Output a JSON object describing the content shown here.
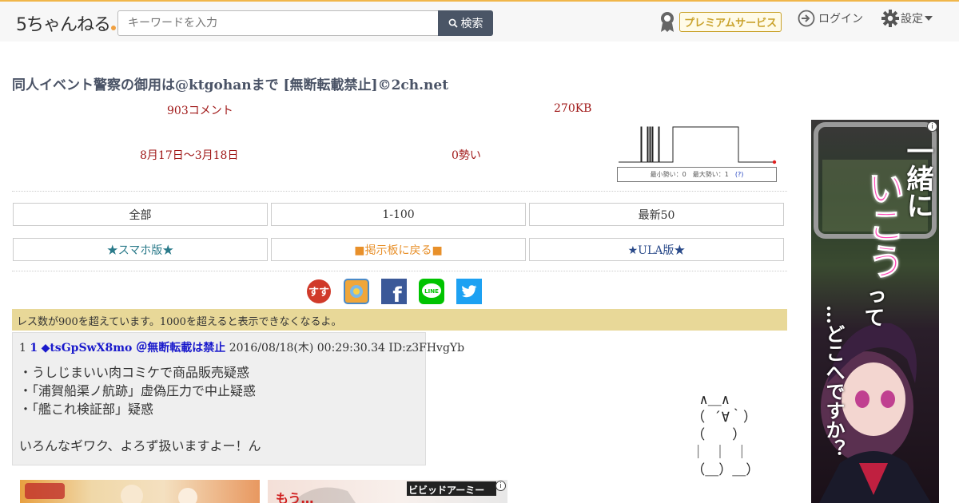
{
  "header": {
    "logo": "5ちゃんねる",
    "search_placeholder": "キーワードを入力",
    "search_button": "検索",
    "premium": "プレミアムサービス",
    "login": "ログイン",
    "settings": "設定"
  },
  "thread": {
    "title": "同人イベント警察の御用は@ktgohanまで [無断転載禁止]©2ch.net",
    "comments": "903コメント",
    "size": "270KB",
    "date_range": "8月17日〜3月18日",
    "momentum": "0勢い",
    "graph_legend_min": "最小勢い：0",
    "graph_legend_max": "最大勢い：1",
    "graph_legend_help": "(?)"
  },
  "nav": {
    "all": "全部",
    "range": "1-100",
    "latest": "最新50",
    "smartphone": "★スマホ版★",
    "back_board": "■掲示板に戻る■",
    "ula": "★ULA版★"
  },
  "social": {
    "icons": [
      "sukisuki-icon",
      "bookmark-icon",
      "facebook-icon",
      "line-icon",
      "twitter-icon"
    ],
    "labels": [
      "すす",
      "",
      "f",
      "LINE",
      ""
    ]
  },
  "notice": "レス数が900を超えています。1000を超えると表示できなくなるよ。",
  "post": {
    "index": "1",
    "number": "1",
    "name": "◆tsGpSwX8mo ＠無断転載は禁止",
    "datetime": "2016/08/18(木) 00:29:30.34",
    "id": "ID:z3FHvgYb",
    "body": "・うしじまいい肉コミケで商品販売疑惑\n・「浦賀船渠ノ航跡」虚偽圧力で中止疑惑\n・「艦これ検証部」疑惑\n\nいろんなギワク、よろず扱いますよー！ん"
  },
  "ascii_art": "  ∧＿∧\n （ ´∀｀）\n （　　）\n ｜ ｜ ｜\n （＿）＿）",
  "side_ad": {
    "text_top": "一緒に",
    "text_pink": "いこう",
    "text_tte": "って",
    "text_bottom": "…どこへですか？",
    "info": "i"
  },
  "bottom_ads": {
    "ad2_label": "ビビッドアーミー",
    "ad2_text": "もう…"
  },
  "colors": {
    "accent": "#f0b64a",
    "title": "#4a5366",
    "meta": "#a01818",
    "notice_bg": "#e8d898",
    "smartphone_link": "#2a7a8a",
    "back_link": "#e8902a",
    "ula_link": "#2a4a8a"
  }
}
